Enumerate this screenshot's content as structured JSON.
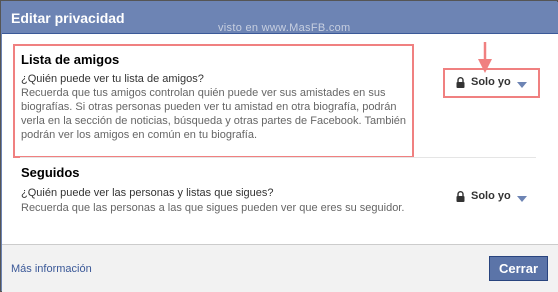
{
  "dialog": {
    "title": "Editar privacidad",
    "watermark": "visto en www.MasFB.com"
  },
  "sections": [
    {
      "title": "Lista de amigos",
      "question": "¿Quién puede ver tu lista de amigos?",
      "description_lines": [
        "Recuerda que tus amigos controlan quién puede ver sus amistades en sus",
        "biografías. Si otras personas pueden ver tu amistad en otra biografía, podrán",
        "verla en la sección de noticias, búsqueda y otras partes de Facebook. También",
        "podrán ver los amigos en común en tu biografía."
      ],
      "audience": "Solo yo"
    },
    {
      "title": "Seguidos",
      "question": "¿Quién puede ver las personas y listas que sigues?",
      "description_lines": [
        "Recuerda que las personas a las que sigues pueden ver que eres su seguidor."
      ],
      "audience": "Solo yo"
    }
  ],
  "footer": {
    "more_info": "Más información",
    "close_label": "Cerrar"
  },
  "colors": {
    "header": "#6d84b4",
    "annotation": "#f08080",
    "button": "#5b74a8",
    "link": "#3b5998"
  },
  "icons": {
    "lock": "lock-icon",
    "dropdown": "chevron-down-icon",
    "annotation_arrow": "arrow-down-icon"
  }
}
